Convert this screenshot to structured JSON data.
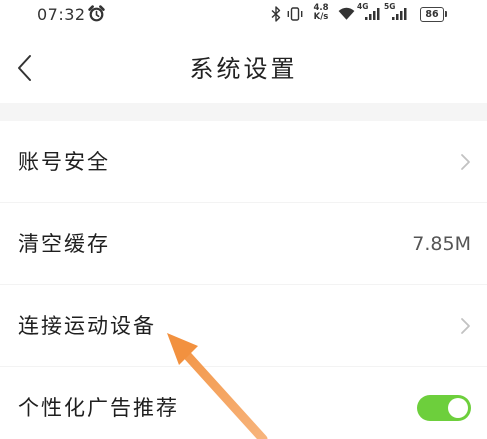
{
  "status_bar": {
    "time": "07:32",
    "alarm_icon": "alarm-icon",
    "bluetooth_icon": "bluetooth-icon",
    "vibrate_icon": "vibrate-icon",
    "net_speed": {
      "value": "4.8",
      "unit": "K/s"
    },
    "wifi_icon": "wifi-icon",
    "sim1": {
      "network": "4G",
      "icon": "signal-bars-icon"
    },
    "sim2": {
      "network": "5G",
      "icon": "signal-bars-icon"
    },
    "battery": {
      "level": "86",
      "icon": "battery-icon"
    }
  },
  "header": {
    "back_icon": "chevron-left-icon",
    "title": "系统设置"
  },
  "settings": {
    "items": [
      {
        "label": "账号安全",
        "trailing_icon": "chevron-right-icon"
      },
      {
        "label": "清空缓存",
        "value": "7.85M"
      },
      {
        "label": "连接运动设备",
        "trailing_icon": "chevron-right-icon"
      },
      {
        "label": "个性化广告推荐",
        "toggle_on": true
      }
    ]
  },
  "annotation": {
    "icon": "arrow-up-left-icon"
  },
  "colors": {
    "toggle_on": "#6dcf3c",
    "annotation_arrow": "#f2913f",
    "section_gap": "#f5f5f5",
    "text_primary": "#222222",
    "chevron": "#c2c2c2"
  }
}
